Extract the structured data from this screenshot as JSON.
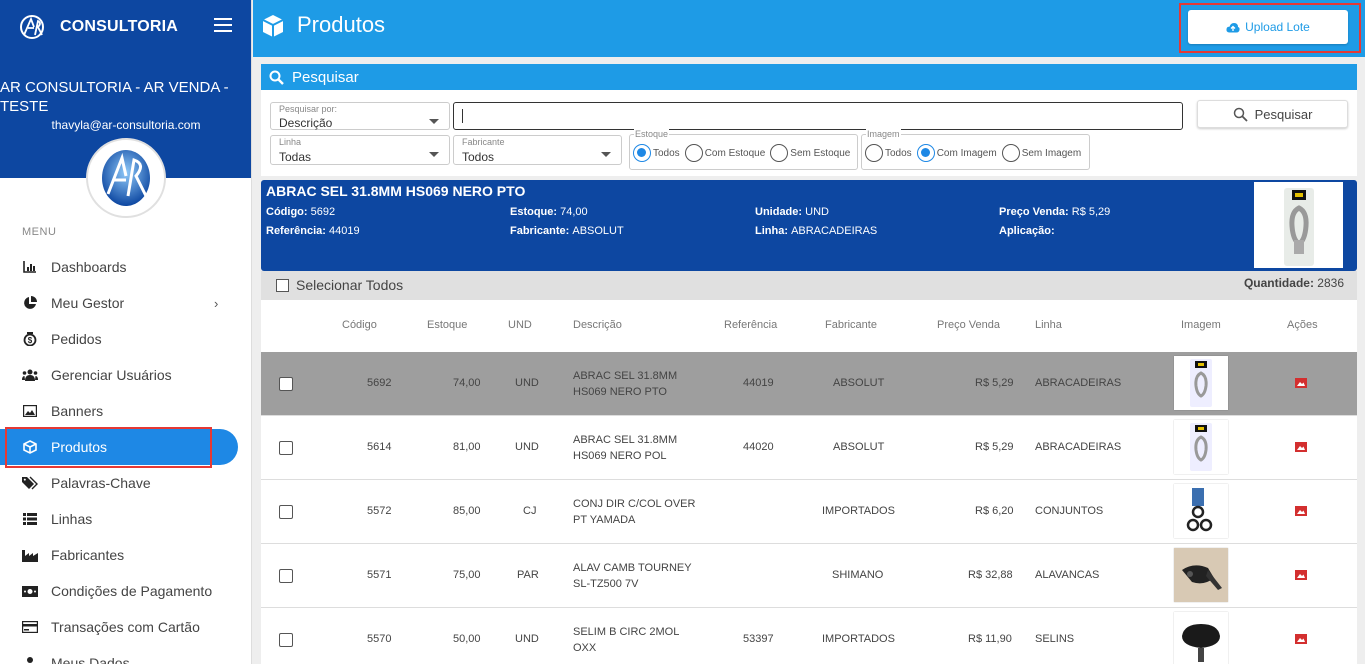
{
  "sidebar": {
    "brand": "CONSULTORIA",
    "company": "AR CONSULTORIA - AR VENDA - TESTE",
    "email": "thavyla@ar-consultoria.com",
    "menu_title": "MENU",
    "items": [
      {
        "label": "Dashboards",
        "icon": "bar-chart-icon"
      },
      {
        "label": "Meu Gestor",
        "icon": "pie-chart-icon"
      },
      {
        "label": "Pedidos",
        "icon": "money-bag-icon"
      },
      {
        "label": "Gerenciar Usuários",
        "icon": "users-icon"
      },
      {
        "label": "Banners",
        "icon": "image-icon"
      },
      {
        "label": "Produtos",
        "icon": "box-icon"
      },
      {
        "label": "Palavras-Chave",
        "icon": "tags-icon"
      },
      {
        "label": "Linhas",
        "icon": "list-icon"
      },
      {
        "label": "Fabricantes",
        "icon": "factory-icon"
      },
      {
        "label": "Condições de Pagamento",
        "icon": "cash-icon"
      },
      {
        "label": "Transações com Cartão",
        "icon": "credit-card-icon"
      },
      {
        "label": "Meus Dados",
        "icon": "user-icon"
      }
    ],
    "active_item": "Produtos"
  },
  "header": {
    "title": "Produtos",
    "upload_label": "Upload Lote"
  },
  "search": {
    "bar_title": "Pesquisar",
    "search_by_label": "Pesquisar por:",
    "search_by_value": "Descrição",
    "query_value": "",
    "button_label": "Pesquisar",
    "linha_label": "Linha",
    "linha_value": "Todas",
    "fabricante_label": "Fabricante",
    "fabricante_value": "Todos",
    "estoque_label": "Estoque",
    "estoque_options": [
      "Todos",
      "Com Estoque",
      "Sem Estoque"
    ],
    "estoque_selected": "Todos",
    "imagem_label": "Imagem",
    "imagem_options": [
      "Todos",
      "Com Imagem",
      "Sem Imagem"
    ],
    "imagem_selected": "Com Imagem"
  },
  "detail": {
    "name": "ABRAC SEL 31.8MM HS069 NERO PTO",
    "codigo_label": "Código:",
    "codigo": "5692",
    "estoque_label": "Estoque:",
    "estoque": "74,00",
    "unidade_label": "Unidade:",
    "unidade": "UND",
    "preco_label": "Preço Venda:",
    "preco": "R$ 5,29",
    "referencia_label": "Referência:",
    "referencia": "44019",
    "fabricante_label": "Fabricante:",
    "fabricante": "ABSOLUT",
    "linha_label": "Linha:",
    "linha": "ABRACADEIRAS",
    "aplicacao_label": "Aplicação:",
    "aplicacao": ""
  },
  "list": {
    "select_all_label": "Selecionar Todos",
    "quantity_label": "Quantidade:",
    "quantity": "2836",
    "columns": [
      "Código",
      "Estoque",
      "UND",
      "Descrição",
      "Referência",
      "Fabricante",
      "Preço Venda",
      "Linha",
      "Imagem",
      "Ações"
    ],
    "rows": [
      {
        "codigo": "5692",
        "estoque": "74,00",
        "und": "UND",
        "desc1": "ABRAC SEL 31.8MM",
        "desc2": "HS069 NERO PTO",
        "ref": "44019",
        "fab": "ABSOLUT",
        "preco": "R$ 5,29",
        "linha": "ABRACADEIRAS",
        "image": "clamp-package",
        "selected": true
      },
      {
        "codigo": "5614",
        "estoque": "81,00",
        "und": "UND",
        "desc1": "ABRAC SEL 31.8MM",
        "desc2": "HS069 NERO POL",
        "ref": "44020",
        "fab": "ABSOLUT",
        "preco": "R$ 5,29",
        "linha": "ABRACADEIRAS",
        "image": "clamp-package",
        "selected": false
      },
      {
        "codigo": "5572",
        "estoque": "85,00",
        "und": "CJ",
        "desc1": "CONJ DIR C/COL OVER",
        "desc2": "PT YAMADA",
        "ref": "",
        "fab": "IMPORTADOS",
        "preco": "R$ 6,20",
        "linha": "CONJUNTOS",
        "image": "bearing-set",
        "selected": false
      },
      {
        "codigo": "5571",
        "estoque": "75,00",
        "und": "PAR",
        "desc1": "ALAV CAMB TOURNEY",
        "desc2": "SL-TZ500 7V",
        "ref": "",
        "fab": "SHIMANO",
        "preco": "R$ 32,88",
        "linha": "ALAVANCAS",
        "image": "shifter",
        "selected": false
      },
      {
        "codigo": "5570",
        "estoque": "50,00",
        "und": "UND",
        "desc1": "SELIM B CIRC 2MOL",
        "desc2": "OXX",
        "ref": "53397",
        "fab": "IMPORTADOS",
        "preco": "R$ 11,90",
        "linha": "SELINS",
        "image": "saddle",
        "selected": false
      }
    ]
  },
  "colors": {
    "sidebar_top": "#0d47a1",
    "header": "#1e9be6",
    "active": "#1e88e5",
    "highlight": "#e53935",
    "selected_row": "#9e9e9e",
    "action_icon": "#d32f2f"
  }
}
